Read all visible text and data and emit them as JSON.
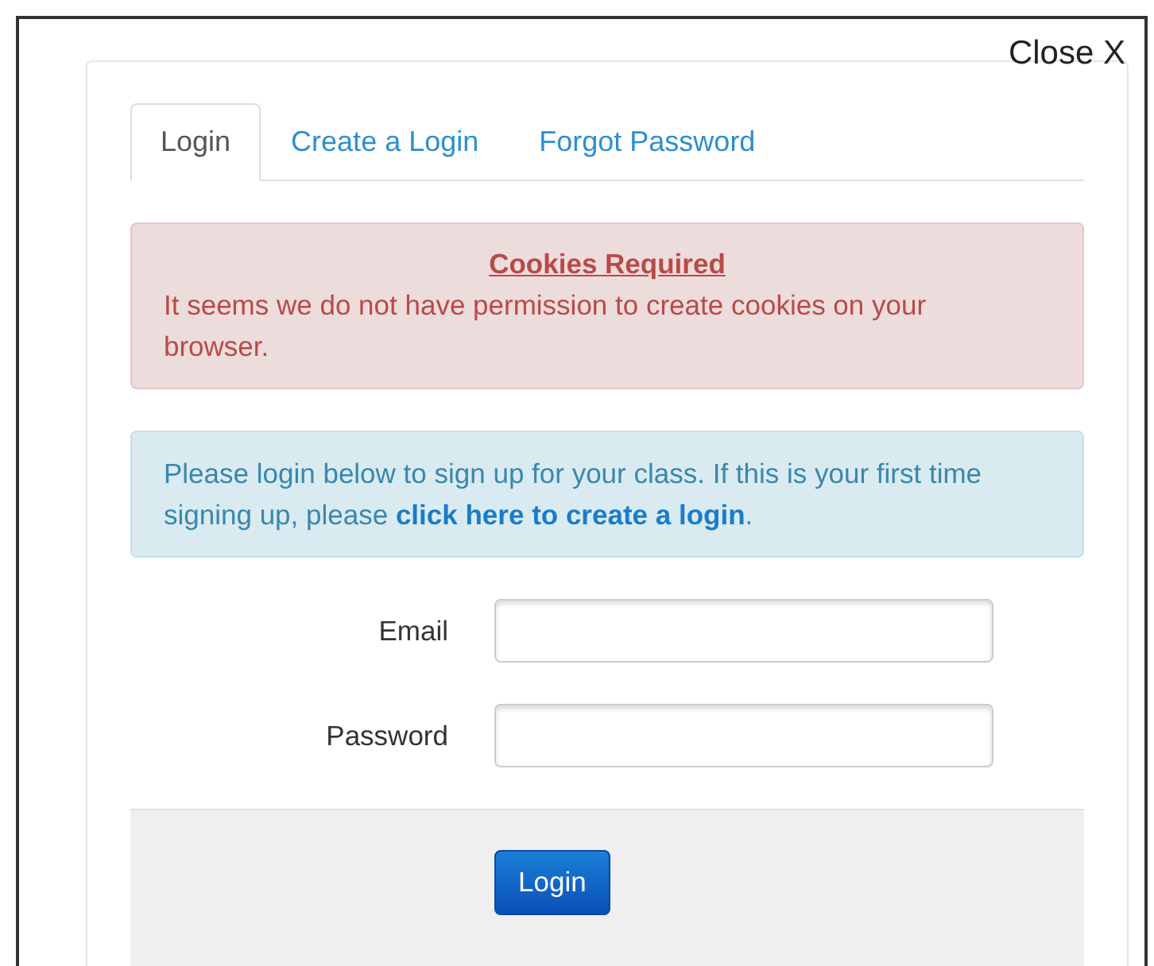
{
  "close_button": {
    "label": "Close X"
  },
  "tabs": [
    {
      "label": "Login",
      "selected": true
    },
    {
      "label": "Create a Login",
      "selected": false
    },
    {
      "label": "Forgot Password",
      "selected": false
    }
  ],
  "error_alert": {
    "title": "Cookies Required",
    "message": "It seems we do not have permission to create cookies on your browser."
  },
  "info_alert": {
    "text": "Please login below to sign up for your class. If this is your first time signing up, please ",
    "link": "click here to create a login",
    "after": "."
  },
  "form": {
    "fields": [
      {
        "label": "Email"
      },
      {
        "label": "Password"
      }
    ],
    "submit": "Login"
  }
}
